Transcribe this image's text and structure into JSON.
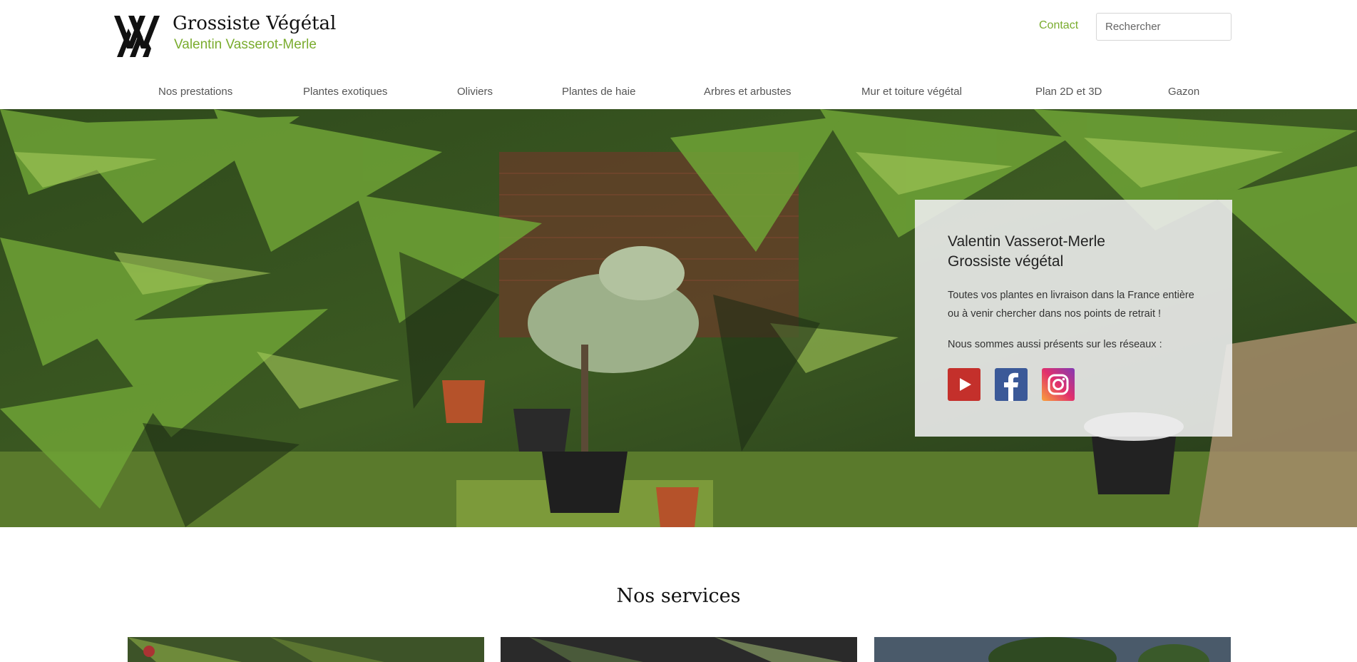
{
  "brand": {
    "title": "Grossiste Végétal",
    "subtitle": "Valentin Vasserot-Merle",
    "accent_color": "#7aac2e",
    "logo_icon": "vvm-monogram-logo"
  },
  "header": {
    "contact_label": "Contact",
    "search_placeholder": "Rechercher"
  },
  "nav": {
    "items": [
      {
        "label": "Nos prestations"
      },
      {
        "label": "Plantes exotiques"
      },
      {
        "label": "Oliviers"
      },
      {
        "label": "Plantes de haie"
      },
      {
        "label": "Arbres et arbustes"
      },
      {
        "label": "Mur et toiture végétal"
      },
      {
        "label": "Plan 2D et 3D"
      },
      {
        "label": "Gazon"
      }
    ]
  },
  "hero": {
    "image_icon": "palm-garden-photo",
    "box": {
      "title_line1": "Valentin Vasserot-Merle",
      "title_line2": "Grossiste végétal",
      "text_line1": "Toutes vos plantes en livraison dans la France entière",
      "text_line2": "ou à venir chercher dans nos points de retrait !",
      "networks_text": "Nous sommes aussi présents sur les réseaux :",
      "socials": [
        {
          "icon": "youtube-icon",
          "color": "#c4302b"
        },
        {
          "icon": "facebook-icon",
          "color": "#3b5998"
        },
        {
          "icon": "instagram-icon",
          "color": "#c13584"
        }
      ]
    }
  },
  "services": {
    "title": "Nos services"
  }
}
